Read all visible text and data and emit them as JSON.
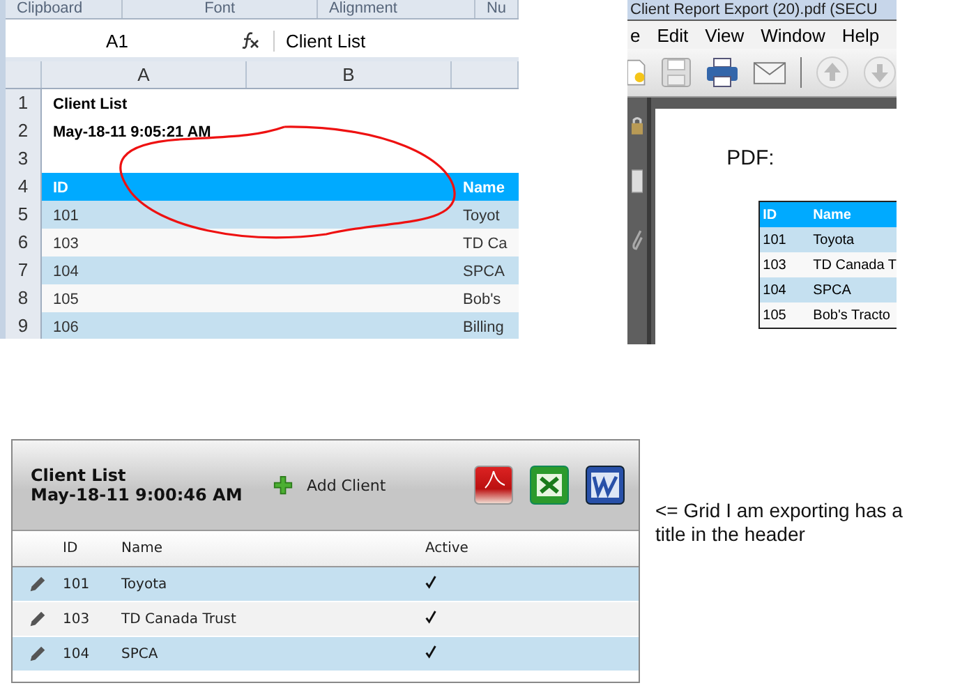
{
  "excel": {
    "ribbon_groups": [
      "Clipboard",
      "Font",
      "Alignment",
      "Nu"
    ],
    "name_box": "A1",
    "formula": "Client List",
    "columns": [
      "A",
      "B"
    ],
    "rows": [
      {
        "number": "1",
        "kind": "title",
        "column_a": "Client List"
      },
      {
        "number": "2",
        "kind": "title",
        "column_a": "May-18-11 9:05:21 AM"
      },
      {
        "number": "3",
        "kind": "blank"
      },
      {
        "number": "4",
        "kind": "header",
        "column_a": "ID",
        "column_c": "Name"
      },
      {
        "number": "5",
        "kind": "data",
        "column_a": "101",
        "column_c": "Toyot"
      },
      {
        "number": "6",
        "kind": "data",
        "column_a": "103",
        "column_c": "TD Ca"
      },
      {
        "number": "7",
        "kind": "data",
        "column_a": "104",
        "column_c": "SPCA"
      },
      {
        "number": "8",
        "kind": "data",
        "column_a": "105",
        "column_c": "Bob's"
      },
      {
        "number": "9",
        "kind": "data",
        "column_a": "106",
        "column_c": "Billing"
      }
    ]
  },
  "pdf": {
    "title": "Client Report Export (20).pdf (SECU",
    "menu": [
      "e",
      "Edit",
      "View",
      "Window",
      "Help"
    ],
    "label": "PDF:",
    "columns": [
      "ID",
      "Name"
    ],
    "rows": [
      [
        "101",
        "Toyota"
      ],
      [
        "103",
        "TD Canada T"
      ],
      [
        "104",
        "SPCA"
      ],
      [
        "105",
        "Bob's Tracto"
      ]
    ]
  },
  "grid": {
    "title": "Client List",
    "date": "May-18-11 9:00:46 AM",
    "add_button": "Add Client",
    "columns": [
      "ID",
      "Name",
      "Active"
    ],
    "rows": [
      {
        "id": "101",
        "name": "Toyota",
        "active": true
      },
      {
        "id": "103",
        "name": "TD Canada Trust",
        "active": true
      },
      {
        "id": "104",
        "name": "SPCA",
        "active": true
      }
    ]
  },
  "note": "<= Grid I am exporting has a title in the header"
}
